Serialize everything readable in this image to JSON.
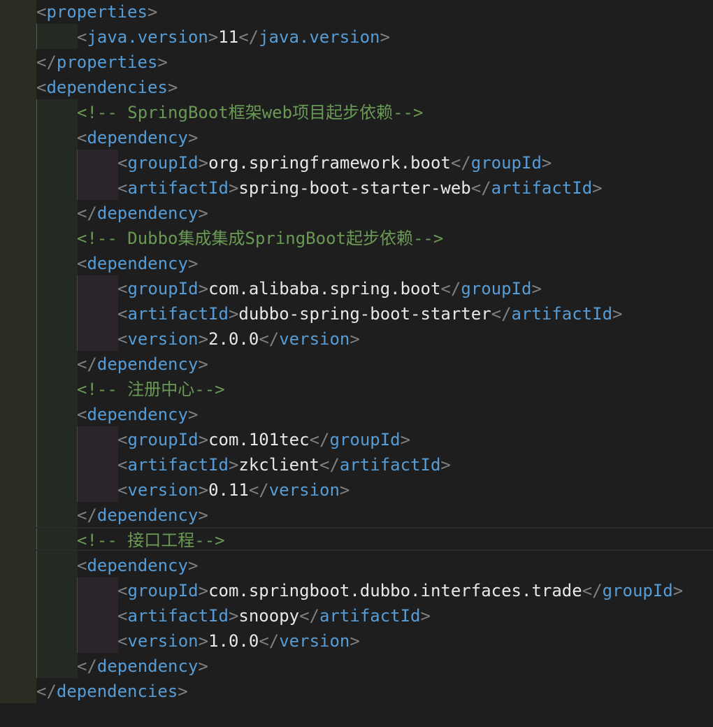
{
  "lines": [
    {
      "depth": 0,
      "kind": "open",
      "tag": "properties"
    },
    {
      "depth": 1,
      "kind": "elem",
      "tag": "java.version",
      "text": "11"
    },
    {
      "depth": 0,
      "kind": "close",
      "tag": "properties"
    },
    {
      "depth": 0,
      "kind": "open",
      "tag": "dependencies"
    },
    {
      "depth": 1,
      "kind": "comment",
      "text": "<!-- SpringBoot框架web项目起步依赖-->"
    },
    {
      "depth": 1,
      "kind": "open",
      "tag": "dependency"
    },
    {
      "depth": 2,
      "kind": "elem",
      "tag": "groupId",
      "text": "org.springframework.boot"
    },
    {
      "depth": 2,
      "kind": "elem",
      "tag": "artifactId",
      "text": "spring-boot-starter-web"
    },
    {
      "depth": 1,
      "kind": "close",
      "tag": "dependency"
    },
    {
      "depth": 1,
      "kind": "comment",
      "text": "<!-- Dubbo集成集成SpringBoot起步依赖-->"
    },
    {
      "depth": 1,
      "kind": "open",
      "tag": "dependency"
    },
    {
      "depth": 2,
      "kind": "elem",
      "tag": "groupId",
      "text": "com.alibaba.spring.boot"
    },
    {
      "depth": 2,
      "kind": "elem",
      "tag": "artifactId",
      "text": "dubbo-spring-boot-starter"
    },
    {
      "depth": 2,
      "kind": "elem",
      "tag": "version",
      "text": "2.0.0"
    },
    {
      "depth": 1,
      "kind": "close",
      "tag": "dependency"
    },
    {
      "depth": 1,
      "kind": "comment",
      "text": "<!-- 注册中心-->"
    },
    {
      "depth": 1,
      "kind": "open",
      "tag": "dependency"
    },
    {
      "depth": 2,
      "kind": "elem",
      "tag": "groupId",
      "text": "com.101tec"
    },
    {
      "depth": 2,
      "kind": "elem",
      "tag": "artifactId",
      "text": "zkclient"
    },
    {
      "depth": 2,
      "kind": "elem",
      "tag": "version",
      "text": "0.11"
    },
    {
      "depth": 1,
      "kind": "close",
      "tag": "dependency"
    },
    {
      "depth": 1,
      "kind": "comment",
      "text": "<!-- 接口工程-->"
    },
    {
      "depth": 1,
      "kind": "open",
      "tag": "dependency"
    },
    {
      "depth": 2,
      "kind": "elem",
      "tag": "groupId",
      "text": "com.springboot.dubbo.interfaces.trade"
    },
    {
      "depth": 2,
      "kind": "elem",
      "tag": "artifactId",
      "text": "snoopy"
    },
    {
      "depth": 2,
      "kind": "elem",
      "tag": "version",
      "text": "1.0.0"
    },
    {
      "depth": 1,
      "kind": "close",
      "tag": "dependency"
    },
    {
      "depth": 0,
      "kind": "close",
      "tag": "dependencies"
    }
  ],
  "colors": {
    "background": "#1e1e1e",
    "gutter": "#2b2d22",
    "tag": "#569cd6",
    "bracket": "#808080",
    "text": "#e8e8e8",
    "comment": "#6a9955"
  }
}
